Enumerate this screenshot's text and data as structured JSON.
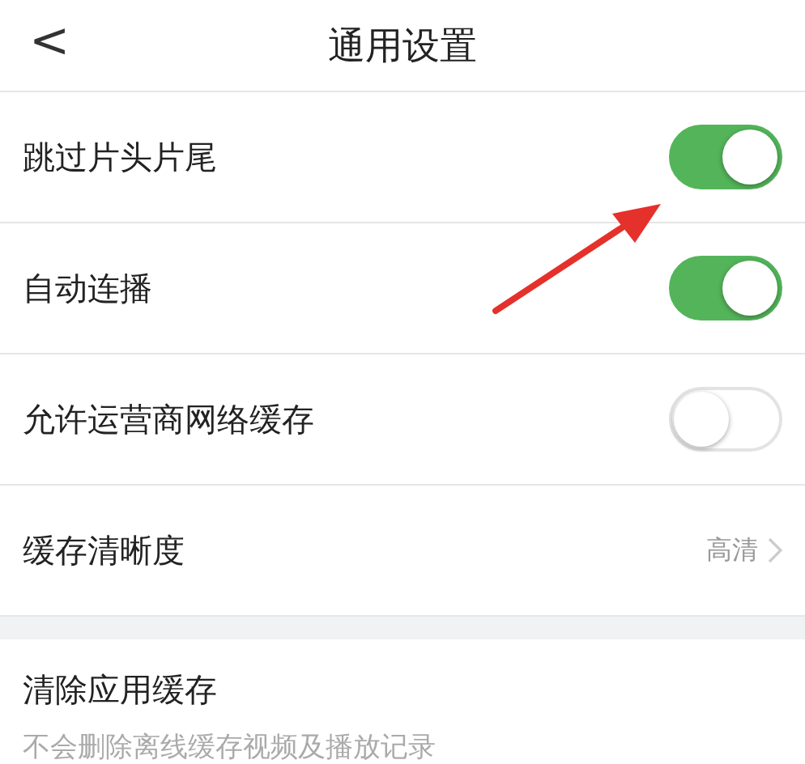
{
  "header": {
    "title": "通用设置",
    "back": "<"
  },
  "settings": [
    {
      "kind": "toggle",
      "label": "跳过片头片尾",
      "on": true
    },
    {
      "kind": "toggle",
      "label": "自动连播",
      "on": true
    },
    {
      "kind": "toggle",
      "label": "允许运营商网络缓存",
      "on": false
    },
    {
      "kind": "value",
      "label": "缓存清晰度",
      "value": "高清"
    }
  ],
  "clear_cache": {
    "title": "清除应用缓存",
    "subtitle": "不会删除离线缓存视频及播放记录"
  },
  "annotation": {
    "kind": "arrow"
  }
}
